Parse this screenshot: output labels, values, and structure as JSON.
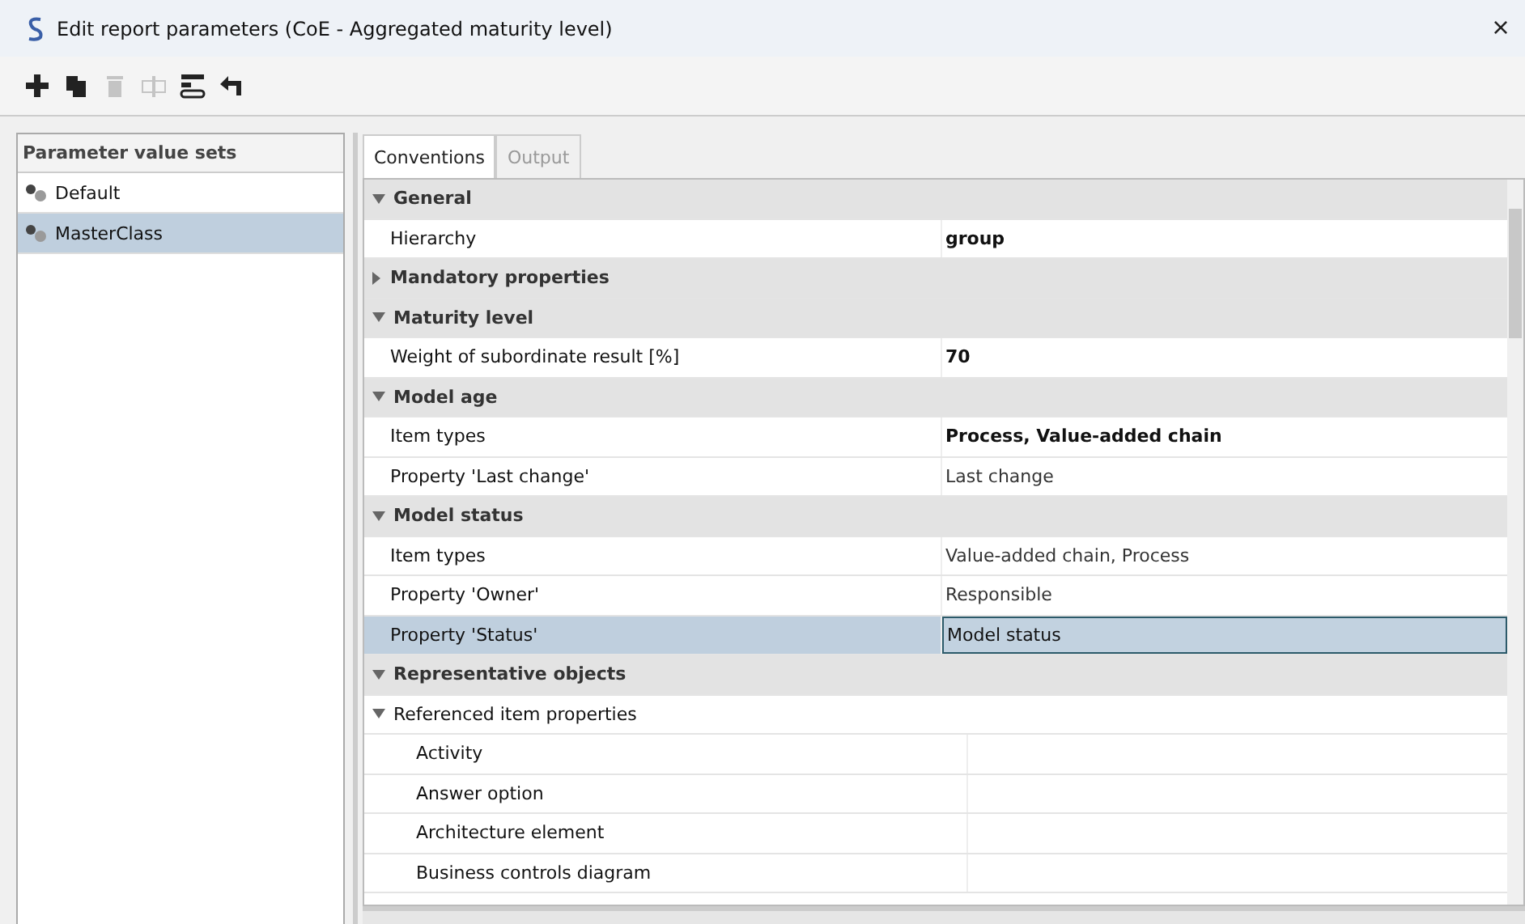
{
  "window": {
    "title": "Edit report parameters (CoE - Aggregated maturity level)",
    "close": "×"
  },
  "toolbar": [
    {
      "kind": "add",
      "disabled": false
    },
    {
      "kind": "copy",
      "disabled": false
    },
    {
      "kind": "delete",
      "disabled": true
    },
    {
      "kind": "rename",
      "disabled": true
    },
    {
      "kind": "layout",
      "disabled": false
    },
    {
      "kind": "back",
      "disabled": false
    }
  ],
  "parameter_sets": {
    "title": "Parameter value sets",
    "items": [
      {
        "label": "Default",
        "selected": false
      },
      {
        "label": "MasterClass",
        "selected": true
      }
    ]
  },
  "tabs": [
    {
      "label": "Conventions",
      "selected": true
    },
    {
      "label": "Output",
      "selected": false
    }
  ],
  "rows": [
    {
      "kind": "group",
      "label": "General",
      "expanded": true
    },
    {
      "kind": "property",
      "label": "Hierarchy",
      "value": "group",
      "bold": true,
      "selected": false
    },
    {
      "kind": "group",
      "label": "Mandatory properties",
      "expanded": false
    },
    {
      "kind": "group",
      "label": "Maturity level",
      "expanded": true
    },
    {
      "kind": "property",
      "label": "Weight of subordinate result [%]",
      "value": "70",
      "bold": true,
      "selected": false
    },
    {
      "kind": "group",
      "label": "Model age",
      "expanded": true
    },
    {
      "kind": "property",
      "label": "Item types",
      "value": "Process, Value-added chain",
      "bold": true,
      "selected": false
    },
    {
      "kind": "property",
      "label": "Property 'Last change'",
      "value": "Last change",
      "bold": false,
      "selected": false
    },
    {
      "kind": "group",
      "label": "Model status",
      "expanded": true
    },
    {
      "kind": "property",
      "label": "Item types",
      "value": "Value-added chain, Process",
      "bold": false,
      "selected": false
    },
    {
      "kind": "property",
      "label": "Property 'Owner'",
      "value": "Responsible",
      "bold": false,
      "selected": false
    },
    {
      "kind": "property",
      "label": "Property 'Status'",
      "value": "Model status",
      "bold": false,
      "selected": true
    },
    {
      "kind": "group",
      "label": "Representative objects",
      "expanded": true
    },
    {
      "kind": "folder",
      "label": "Referenced item properties",
      "expanded": true,
      "children": [
        {
          "label": "Activity"
        },
        {
          "label": "Answer option"
        },
        {
          "label": "Architecture element"
        },
        {
          "label": "Business controls diagram"
        }
      ]
    }
  ]
}
